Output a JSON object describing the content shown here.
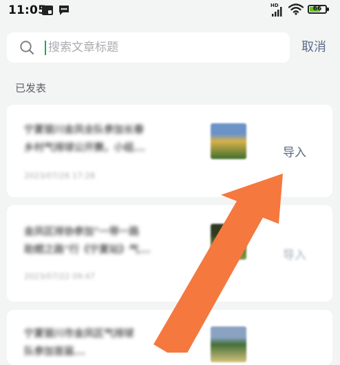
{
  "status_bar": {
    "time": "11:05",
    "network_label": "HD",
    "battery_level": "66",
    "battery_fraction": 0.66
  },
  "search": {
    "placeholder": "搜索文章标题",
    "cancel_label": "取消"
  },
  "section": {
    "title": "已发表"
  },
  "articles": [
    {
      "title": "宁夏银川金凤全队参加长春\n乡村气排球公开赛，小组...",
      "time": "2023/07/26 17:28",
      "import_label": "导入",
      "thumb_colors": [
        "#6b93c8",
        "#d7b24a",
        "#3e6d2e"
      ]
    },
    {
      "title": "金凤区排协参加\"一带一路\n助燃之路\"行《宁夏站》气...",
      "time": "2023/07/22 09:47",
      "import_label": "导入",
      "thumb_colors": [
        "#2f3a22",
        "#4d6b2c",
        "#7c9a4a"
      ]
    },
    {
      "title": "宁夏银川市金凤区气排球\n队参加首届...",
      "time": "",
      "import_label": "",
      "thumb_colors": [
        "#8aa3c2",
        "#456f3a",
        "#d3c27a"
      ]
    }
  ],
  "colors": {
    "accent_link": "#5a6884",
    "caret": "#1fa552",
    "arrow": "#f5783f",
    "battery_fill": "#62c322"
  },
  "icons": {
    "search": "search-icon",
    "signal": "signal-icon",
    "wifi": "wifi-icon",
    "battery": "battery-icon",
    "notification": "notification-icon",
    "message": "message-icon",
    "arrow": "pointing-arrow"
  }
}
